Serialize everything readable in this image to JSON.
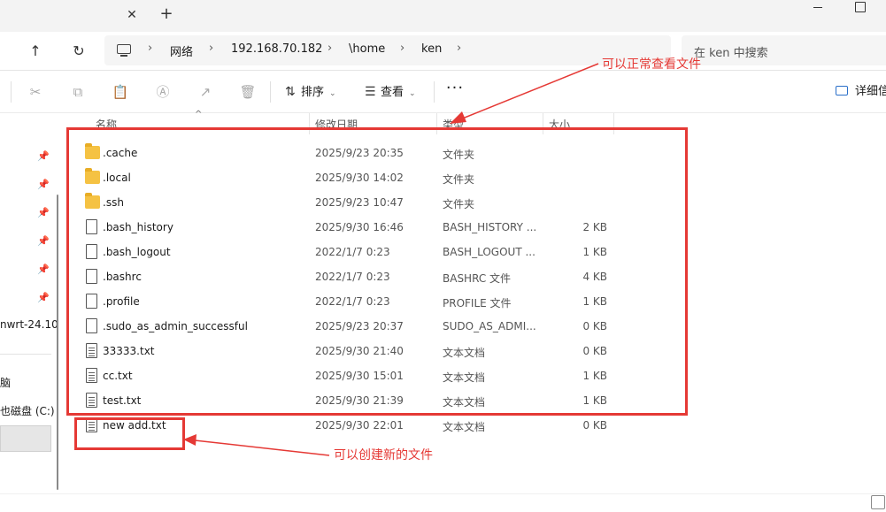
{
  "window": {
    "tab_close": "✕",
    "tab_new": "+"
  },
  "address": {
    "crumbs": [
      "网络",
      "192.168.70.182",
      "\\home",
      "ken"
    ],
    "separator": "›"
  },
  "search": {
    "placeholder": "在 ken 中搜索"
  },
  "toolbar": {
    "sort_label": "排序",
    "view_label": "查看",
    "more_label": "···",
    "details_label": "详细信"
  },
  "navpane": {
    "items": [
      {
        "label": "nwrt-24.10"
      },
      {
        "label": "脑"
      },
      {
        "label": "也磁盘 (C:)"
      }
    ]
  },
  "columns": {
    "name": "名称",
    "modified": "修改日期",
    "type": "类型",
    "size": "大小"
  },
  "files": [
    {
      "name": ".cache",
      "modified": "2025/9/23 20:35",
      "type": "文件夹",
      "size": "",
      "icon": "folder-icon"
    },
    {
      "name": ".local",
      "modified": "2025/9/30 14:02",
      "type": "文件夹",
      "size": "",
      "icon": "folder-icon"
    },
    {
      "name": ".ssh",
      "modified": "2025/9/23 10:47",
      "type": "文件夹",
      "size": "",
      "icon": "folder-icon"
    },
    {
      "name": ".bash_history",
      "modified": "2025/9/30 16:46",
      "type": "BASH_HISTORY ...",
      "size": "2 KB",
      "icon": "file-icon"
    },
    {
      "name": ".bash_logout",
      "modified": "2022/1/7 0:23",
      "type": "BASH_LOGOUT ...",
      "size": "1 KB",
      "icon": "file-icon"
    },
    {
      "name": ".bashrc",
      "modified": "2022/1/7 0:23",
      "type": "BASHRC 文件",
      "size": "4 KB",
      "icon": "file-icon"
    },
    {
      "name": ".profile",
      "modified": "2022/1/7 0:23",
      "type": "PROFILE 文件",
      "size": "1 KB",
      "icon": "file-icon"
    },
    {
      "name": ".sudo_as_admin_successful",
      "modified": "2025/9/23 20:37",
      "type": "SUDO_AS_ADMI...",
      "size": "0 KB",
      "icon": "file-icon"
    },
    {
      "name": "33333.txt",
      "modified": "2025/9/30 21:40",
      "type": "文本文档",
      "size": "0 KB",
      "icon": "text-file-icon"
    },
    {
      "name": "cc.txt",
      "modified": "2025/9/30 15:01",
      "type": "文本文档",
      "size": "1 KB",
      "icon": "text-file-icon"
    },
    {
      "name": "test.txt",
      "modified": "2025/9/30 21:39",
      "type": "文本文档",
      "size": "1 KB",
      "icon": "text-file-icon"
    },
    {
      "name": "new add.txt",
      "modified": "2025/9/30 22:01",
      "type": "文本文档",
      "size": "0 KB",
      "icon": "text-file-icon"
    }
  ],
  "annotations": {
    "view_note": "可以正常查看文件",
    "create_note": "可以创建新的文件",
    "color": "#e53935"
  },
  "colors": {
    "accent": "#2a6fc9",
    "folder": "#f5c243"
  }
}
